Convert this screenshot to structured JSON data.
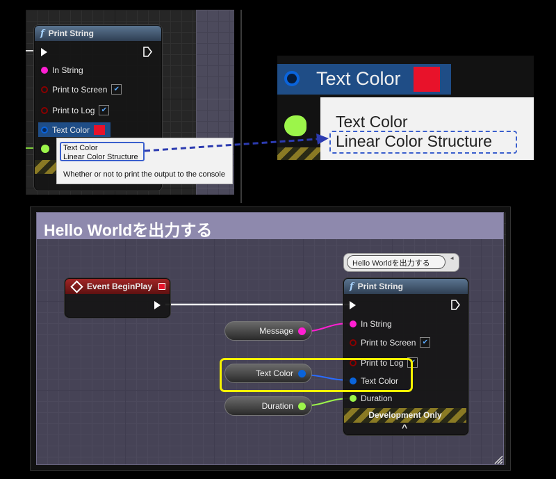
{
  "top_panel": {
    "node_title": "Print String",
    "pins": {
      "in_string": "In String",
      "print_to_screen": "Print to Screen",
      "print_to_log": "Print to Log",
      "text_color": "Text Color"
    },
    "tooltip": {
      "line1": "Text Color",
      "line2": "Linear Color Structure",
      "description": "Whether or not to print the output to the console"
    }
  },
  "zoom_panel": {
    "pin_label": "Text Color",
    "tooltip_line1": "Text Color",
    "tooltip_line2": "Linear Color Structure"
  },
  "graph": {
    "comment_title": "Hello Worldを出力する",
    "bubble_text": "Hello Worldを出力する",
    "event_node_title": "Event BeginPlay",
    "print_node": {
      "title": "Print String",
      "pins": {
        "in_string": "In String",
        "print_to_screen": "Print to Screen",
        "print_to_log": "Print to Log",
        "text_color": "Text Color",
        "duration": "Duration"
      },
      "footer": "Development Only",
      "expand_arrow": "^"
    },
    "variables": {
      "message": "Message",
      "text_color": "Text Color",
      "duration": "Duration"
    }
  },
  "colors": {
    "string_pin": "#ff1fd2",
    "bool_pin": "#8a0000",
    "struct_pin": "#0a64dc",
    "float_pin": "#9cf54a",
    "highlight": "#f6f200",
    "swatch": "#e8122a",
    "tooltip_border": "#3a5fcd"
  }
}
